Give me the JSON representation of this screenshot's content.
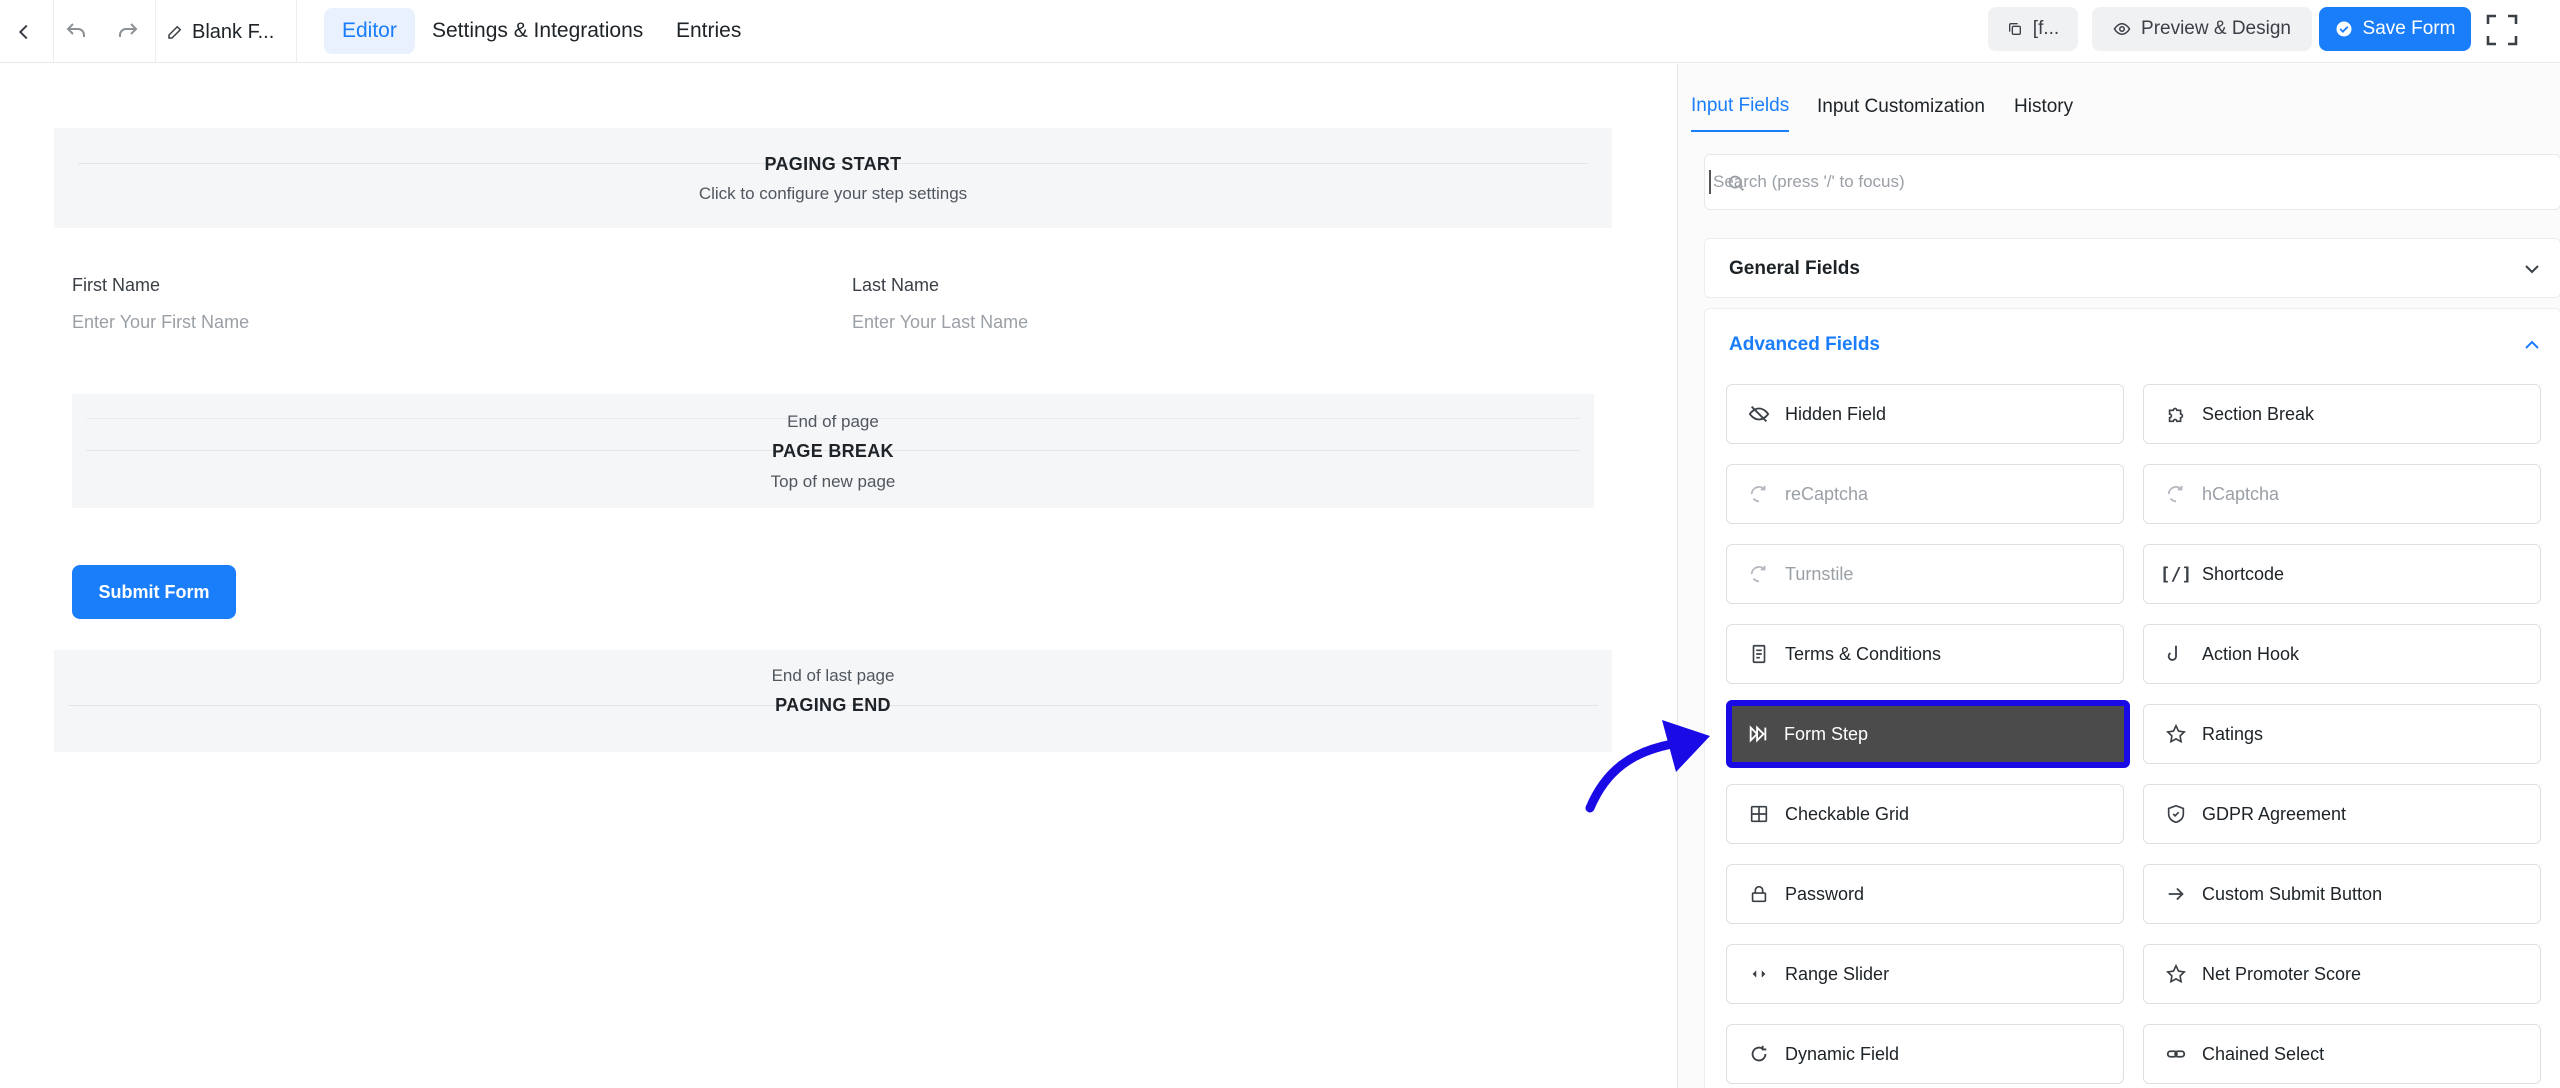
{
  "topbar": {
    "form_title": "Blank F...",
    "tabs": [
      {
        "label": "Editor"
      },
      {
        "label": "Settings & Integrations"
      },
      {
        "label": "Entries"
      }
    ],
    "shortcode_label": "[f...",
    "preview_label": "Preview & Design",
    "save_label": "Save Form"
  },
  "editor": {
    "paging_start": {
      "title": "PAGING START",
      "subtitle": "Click to configure your step settings"
    },
    "fields": [
      {
        "label": "First Name",
        "placeholder": "Enter Your First Name"
      },
      {
        "label": "Last Name",
        "placeholder": "Enter Your Last Name"
      }
    ],
    "page_break": {
      "top": "End of page",
      "title": "PAGE BREAK",
      "bottom": "Top of new page"
    },
    "submit_label": "Submit Form",
    "paging_end": {
      "top": "End of last page",
      "title": "PAGING END"
    }
  },
  "sidebar": {
    "tabs": [
      {
        "label": "Input Fields"
      },
      {
        "label": "Input Customization"
      },
      {
        "label": "History"
      }
    ],
    "search_placeholder": "Search (press '/' to focus)",
    "general_title": "General Fields",
    "advanced_title": "Advanced Fields",
    "advanced_fields": [
      {
        "label": "Hidden Field",
        "icon": "eye-off-icon"
      },
      {
        "label": "Section Break",
        "icon": "puzzle-icon"
      },
      {
        "label": "reCaptcha",
        "icon": "captcha-icon"
      },
      {
        "label": "hCaptcha",
        "icon": "captcha-icon"
      },
      {
        "label": "Turnstile",
        "icon": "captcha-icon"
      },
      {
        "label": "Shortcode",
        "icon": "shortcode-icon"
      },
      {
        "label": "Terms & Conditions",
        "icon": "document-icon"
      },
      {
        "label": "Action Hook",
        "icon": "hook-icon"
      },
      {
        "label": "Form Step",
        "icon": "skip-icon"
      },
      {
        "label": "Ratings",
        "icon": "star-icon"
      },
      {
        "label": "Checkable Grid",
        "icon": "grid-icon"
      },
      {
        "label": "GDPR Agreement",
        "icon": "shield-icon"
      },
      {
        "label": "Password",
        "icon": "lock-icon"
      },
      {
        "label": "Custom Submit Button",
        "icon": "arrow-right-icon"
      },
      {
        "label": "Range Slider",
        "icon": "slider-icon"
      },
      {
        "label": "Net Promoter Score",
        "icon": "star-icon"
      },
      {
        "label": "Dynamic Field",
        "icon": "refresh-icon"
      },
      {
        "label": "Chained Select",
        "icon": "link-icon"
      }
    ]
  },
  "colors": {
    "accent": "#1a7efb",
    "highlight_border": "#1a0ae6",
    "highlight_fill": "#4b4b4b"
  }
}
